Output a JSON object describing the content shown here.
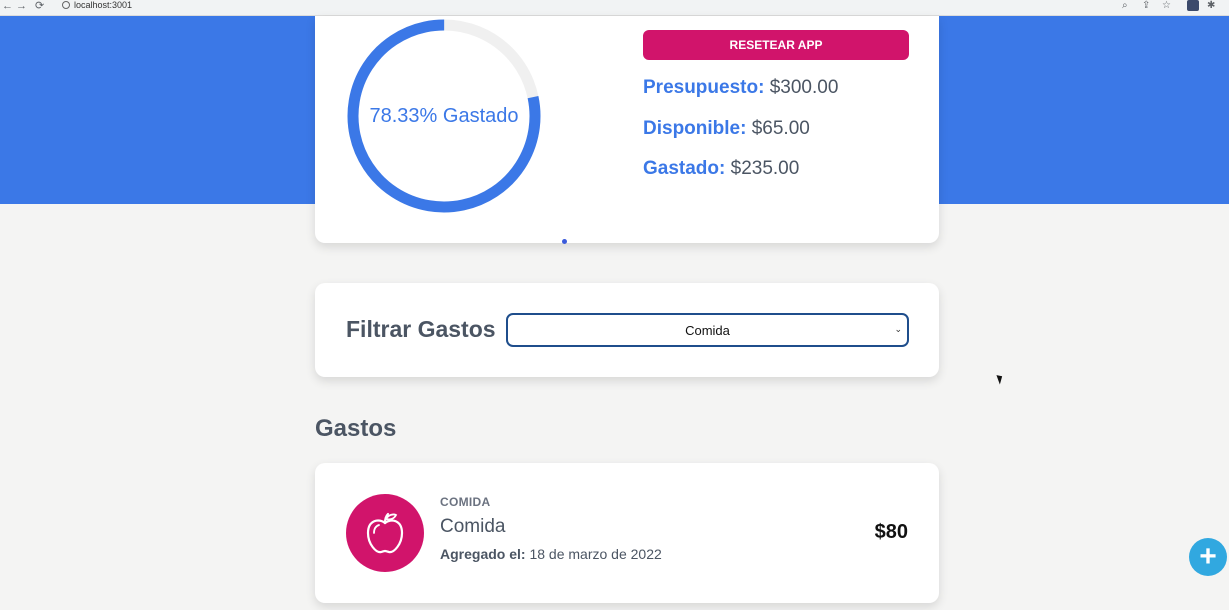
{
  "browser": {
    "url": "localhost:3001",
    "back_glyph": "←",
    "forward_glyph": "→",
    "reload_glyph": "⟳",
    "zoom_glyph": "⌕",
    "share_glyph": "⇪",
    "star_glyph": "☆",
    "ext_glyph": "✱"
  },
  "budget": {
    "percent_spent": 78.33,
    "progress_label": "78.33% Gastado",
    "reset_label": "RESETEAR APP",
    "presupuesto_label": "Presupuesto:",
    "presupuesto_value": "$300.00",
    "disponible_label": "Disponible:",
    "disponible_value": "$65.00",
    "gastado_label": "Gastado:",
    "gastado_value": "$235.00",
    "accent_color": "#3b78e7",
    "reset_color": "#d1146b"
  },
  "filter": {
    "label": "Filtrar Gastos",
    "selected": "Comida"
  },
  "expenses": {
    "title": "Gastos",
    "items": [
      {
        "category": "COMIDA",
        "name": "Comida",
        "date_label": "Agregado el:",
        "date_value": "18 de marzo de 2022",
        "amount": "$80",
        "icon": "apple-icon"
      }
    ]
  },
  "fab": {
    "label": "+"
  }
}
